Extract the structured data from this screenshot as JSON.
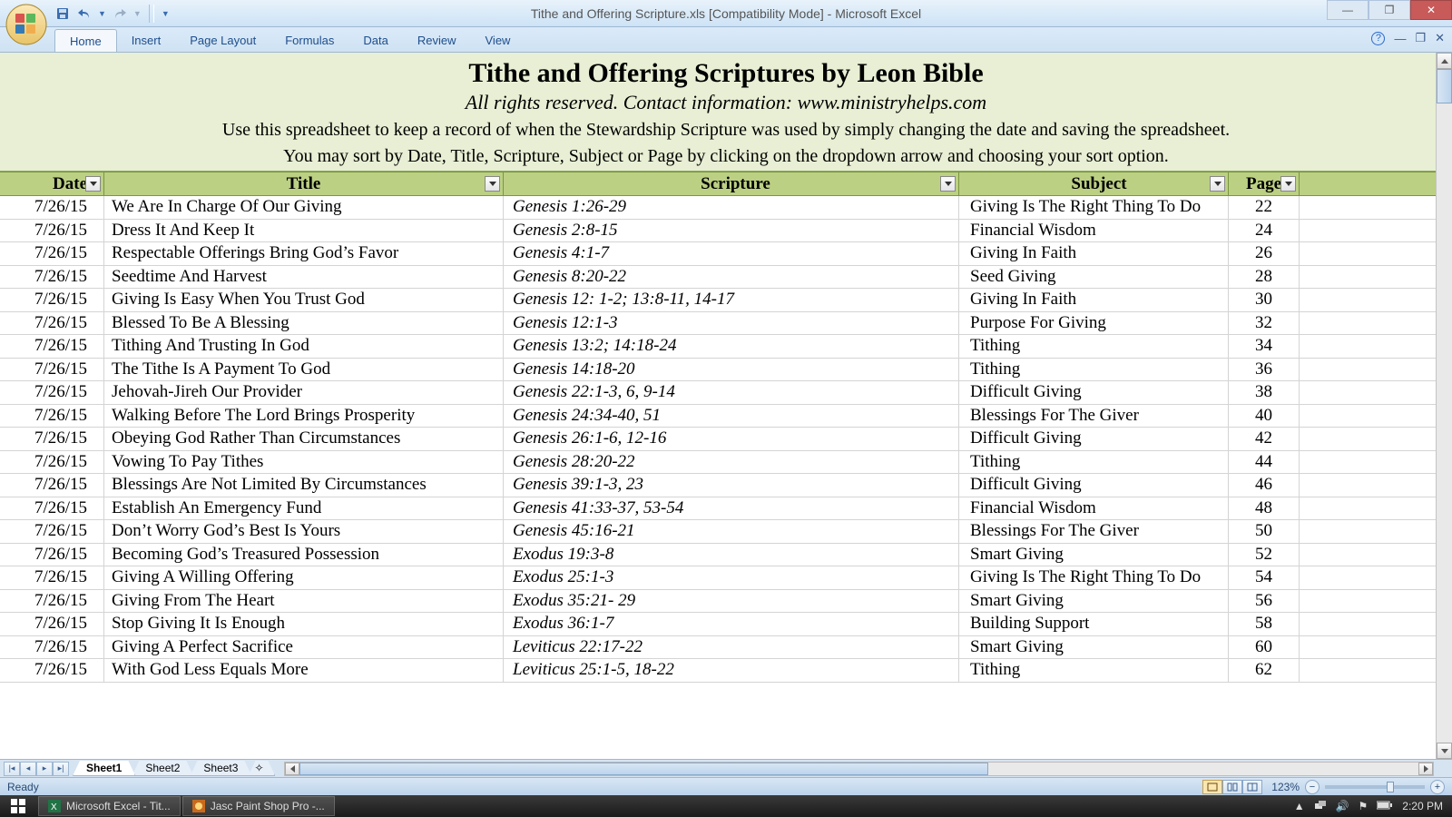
{
  "window": {
    "title": "Tithe and Offering Scripture.xls  [Compatibility Mode] - Microsoft Excel"
  },
  "qat": {
    "save": "save",
    "undo": "undo",
    "redo": "redo"
  },
  "ribbon": {
    "tabs": [
      "Home",
      "Insert",
      "Page Layout",
      "Formulas",
      "Data",
      "Review",
      "View"
    ],
    "active": 0
  },
  "header": {
    "title": "Tithe and Offering Scriptures by Leon Bible",
    "subtitle": "All rights reserved. Contact information: www.ministryhelps.com",
    "inst1": "Use this spreadsheet to keep a record of when the Stewardship Scripture was used by simply changing the date and saving the spreadsheet.",
    "inst2": "You may sort by Date, Title, Scripture, Subject or Page by clicking on the dropdown arrow and choosing your sort option."
  },
  "columns": [
    "Date",
    "Title",
    "Scripture",
    "Subject",
    "Page"
  ],
  "rows": [
    {
      "date": "7/26/15",
      "title": "We Are In Charge Of Our Giving",
      "scripture": "Genesis 1:26-29",
      "subject": "Giving Is The Right Thing To Do",
      "page": "22"
    },
    {
      "date": "7/26/15",
      "title": "Dress It And Keep It",
      "scripture": "Genesis 2:8-15",
      "subject": "Financial Wisdom",
      "page": "24"
    },
    {
      "date": "7/26/15",
      "title": "Respectable Offerings Bring God’s Favor",
      "scripture": "Genesis 4:1-7",
      "subject": "Giving In Faith",
      "page": "26"
    },
    {
      "date": "7/26/15",
      "title": "Seedtime And Harvest",
      "scripture": "Genesis 8:20-22",
      "subject": "Seed Giving",
      "page": "28"
    },
    {
      "date": "7/26/15",
      "title": "Giving Is Easy When You Trust God",
      "scripture": "Genesis 12: 1-2; 13:8-11, 14-17",
      "subject": "Giving In Faith",
      "page": "30"
    },
    {
      "date": "7/26/15",
      "title": "Blessed To Be A Blessing",
      "scripture": "Genesis 12:1-3",
      "subject": "Purpose For Giving",
      "page": "32"
    },
    {
      "date": "7/26/15",
      "title": "Tithing And Trusting In God",
      "scripture": "Genesis 13:2; 14:18-24",
      "subject": "Tithing",
      "page": "34"
    },
    {
      "date": "7/26/15",
      "title": "The Tithe Is A Payment To God",
      "scripture": "Genesis 14:18-20",
      "subject": "Tithing",
      "page": "36"
    },
    {
      "date": "7/26/15",
      "title": "Jehovah-Jireh Our Provider",
      "scripture": "Genesis 22:1-3, 6, 9-14",
      "subject": "Difficult Giving",
      "page": "38"
    },
    {
      "date": "7/26/15",
      "title": "Walking Before The Lord Brings Prosperity",
      "scripture": "Genesis 24:34-40, 51",
      "subject": "Blessings For The Giver",
      "page": "40"
    },
    {
      "date": "7/26/15",
      "title": "Obeying God Rather Than Circumstances",
      "scripture": "Genesis 26:1-6, 12-16",
      "subject": "Difficult Giving",
      "page": "42"
    },
    {
      "date": "7/26/15",
      "title": "Vowing To Pay Tithes",
      "scripture": "Genesis 28:20-22",
      "subject": "Tithing",
      "page": "44"
    },
    {
      "date": "7/26/15",
      "title": "Blessings Are Not Limited By Circumstances",
      "scripture": "Genesis 39:1-3, 23",
      "subject": "Difficult Giving",
      "page": "46"
    },
    {
      "date": "7/26/15",
      "title": "Establish An Emergency Fund",
      "scripture": "Genesis 41:33-37, 53-54",
      "subject": "Financial Wisdom",
      "page": "48"
    },
    {
      "date": "7/26/15",
      "title": "Don’t Worry God’s Best Is Yours",
      "scripture": "Genesis 45:16-21",
      "subject": "Blessings For The Giver",
      "page": "50"
    },
    {
      "date": "7/26/15",
      "title": "Becoming God’s Treasured Possession",
      "scripture": "Exodus 19:3-8",
      "subject": "Smart Giving",
      "page": "52"
    },
    {
      "date": "7/26/15",
      "title": "Giving A Willing Offering",
      "scripture": "Exodus 25:1-3",
      "subject": "Giving Is The Right Thing To Do",
      "page": "54"
    },
    {
      "date": "7/26/15",
      "title": "Giving From The Heart",
      "scripture": "Exodus 35:21- 29",
      "subject": "Smart Giving",
      "page": "56"
    },
    {
      "date": "7/26/15",
      "title": "Stop Giving It Is Enough",
      "scripture": "Exodus 36:1-7",
      "subject": "Building Support",
      "page": "58"
    },
    {
      "date": "7/26/15",
      "title": "Giving A Perfect Sacrifice",
      "scripture": "Leviticus 22:17-22",
      "subject": "Smart Giving",
      "page": "60"
    },
    {
      "date": "7/26/15",
      "title": "With God Less Equals More",
      "scripture": "Leviticus 25:1-5, 18-22",
      "subject": "Tithing",
      "page": "62"
    }
  ],
  "sheets": {
    "tabs": [
      "Sheet1",
      "Sheet2",
      "Sheet3"
    ],
    "active": 0
  },
  "status": {
    "ready": "Ready",
    "zoom": "123%"
  },
  "taskbar": {
    "items": [
      "Microsoft Excel - Tit...",
      "Jasc Paint Shop Pro -..."
    ],
    "clock": "2:20 PM"
  }
}
